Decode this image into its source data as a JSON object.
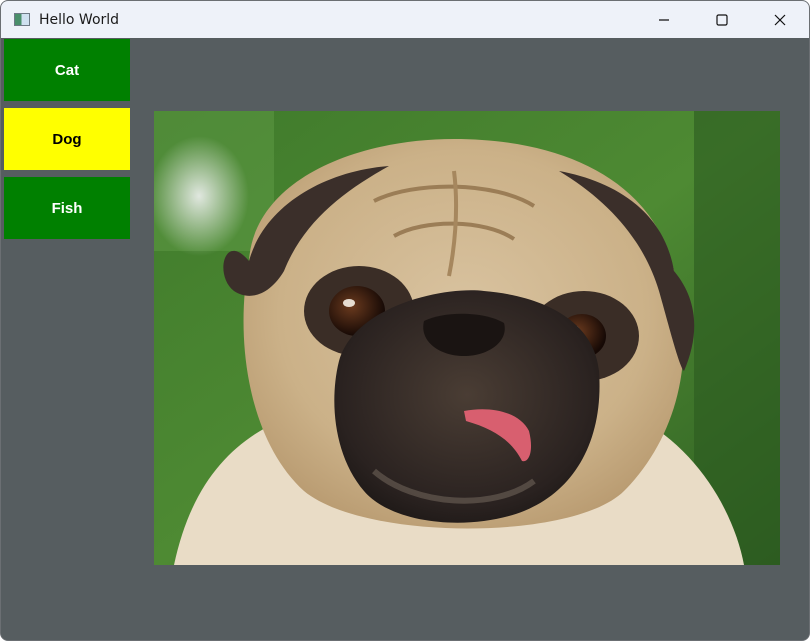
{
  "window": {
    "title": "Hello World",
    "controls": [
      "minimize",
      "maximize",
      "close"
    ]
  },
  "sidebar": {
    "items": [
      {
        "label": "Cat",
        "bg": "#008000",
        "fg": "#ffffff"
      },
      {
        "label": "Dog",
        "bg": "#ffff00",
        "fg": "#000000"
      },
      {
        "label": "Fish",
        "bg": "#008000",
        "fg": "#ffffff"
      }
    ]
  },
  "main": {
    "image": {
      "subject": "pug dog photo"
    }
  },
  "colors": {
    "content_bg": "#565d60",
    "titlebar_bg": "#eef2f9"
  }
}
